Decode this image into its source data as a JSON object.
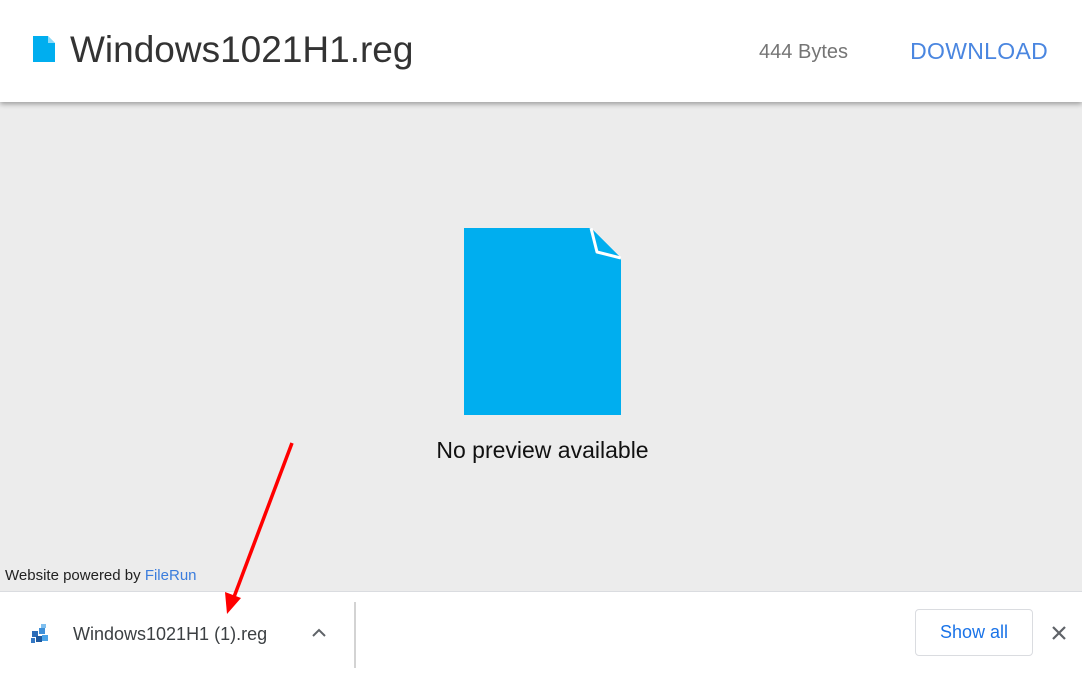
{
  "header": {
    "file_name": "Windows1021H1.reg",
    "file_size": "444 Bytes",
    "download_label": "DOWNLOAD",
    "file_icon": "file-icon"
  },
  "preview": {
    "message": "No preview available",
    "icon": "file-icon",
    "icon_color": "#00aeef"
  },
  "footer": {
    "powered_text": "Website powered by ",
    "powered_link": "FileRun"
  },
  "download_bar": {
    "item_name": "Windows1021H1 (1).reg",
    "item_icon": "registry-file-icon",
    "expand_icon": "chevron-up-icon",
    "show_all_label": "Show all",
    "close_icon": "close-icon"
  },
  "annotation": {
    "arrow_color": "#ff0000"
  },
  "colors": {
    "accent": "#4a86e0",
    "file_blue": "#00aeef",
    "preview_bg": "#ececec"
  }
}
